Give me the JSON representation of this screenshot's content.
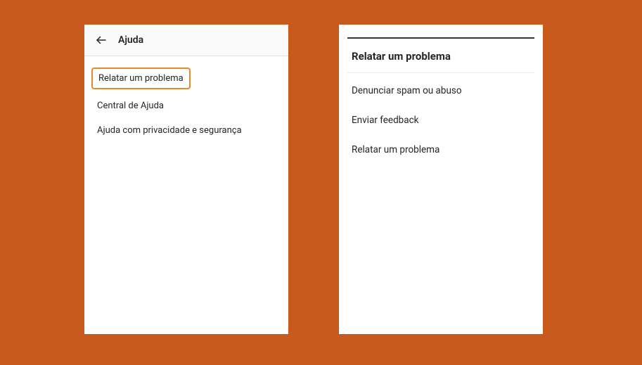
{
  "left": {
    "title": "Ajuda",
    "items": [
      {
        "label": "Relatar um problema"
      },
      {
        "label": "Central de Ajuda"
      },
      {
        "label": "Ajuda com privacidade e segurança"
      }
    ]
  },
  "right": {
    "title": "Relatar um problema",
    "items": [
      {
        "label": "Denunciar spam ou abuso"
      },
      {
        "label": "Enviar feedback"
      },
      {
        "label": "Relatar um problema"
      }
    ]
  }
}
